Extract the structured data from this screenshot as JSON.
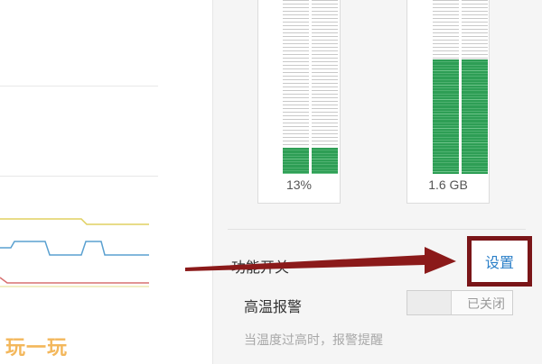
{
  "meters": [
    {
      "label": "13%",
      "fill": 0.15
    },
    {
      "label": "1.6 GB",
      "fill": 0.66
    }
  ],
  "feature_switch": {
    "label": "功能开关",
    "settings_label": "设置"
  },
  "high_temp_alert": {
    "label": "高温报警",
    "toggle_state": "已关闭",
    "hint": "当温度过高时，报警提醒"
  },
  "watermark": "玩一玩",
  "colors": {
    "meter_fill": "#2e9e55",
    "highlight_border": "#7a1518",
    "arrow": "#8b1a1a",
    "link": "#2a7fc8",
    "graph_yellow": "#e0d060",
    "graph_blue": "#5aa0d0",
    "graph_red": "#d77070"
  }
}
